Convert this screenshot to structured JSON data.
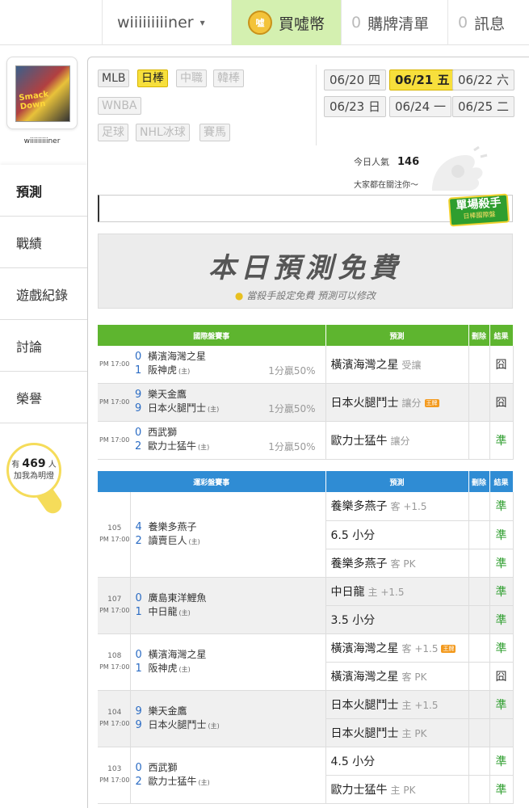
{
  "topbar": {
    "username": "wiiiiiiiiiner",
    "caret": "▾",
    "coin_icon": "噓",
    "coin_label": "買噓幣",
    "cart_count": "0",
    "cart_label": "購牌清單",
    "msg_count": "0",
    "msg_label": "訊息"
  },
  "sidebar": {
    "avatar_text": "Smack Down",
    "username": "wiiiiiiiiiner",
    "nav": [
      "預測",
      "戰績",
      "遊戲紀錄",
      "討論",
      "榮譽"
    ],
    "fans_prefix": "有",
    "fans_count": "469",
    "fans_suffix": "人",
    "fans_text": "加我為明燈"
  },
  "leagues": [
    "MLB",
    "日棒",
    "中職",
    "韓棒",
    "WNBA",
    "足球",
    "NHL冰球",
    "賽馬"
  ],
  "dates": [
    {
      "d": "06/20",
      "w": "四"
    },
    {
      "d": "06/21",
      "w": "五"
    },
    {
      "d": "06/22",
      "w": "六"
    },
    {
      "d": "06/23",
      "w": "日"
    },
    {
      "d": "06/24",
      "w": "一"
    },
    {
      "d": "06/25",
      "w": "二"
    }
  ],
  "popularity": {
    "label": "今日人氣",
    "value": "146",
    "sub": "大家都在關注你～"
  },
  "killer_badge": {
    "title": "單場殺手",
    "sub": "日棒國際盤"
  },
  "banner": {
    "title": "本日預測免費",
    "sub": "當殺手設定免費 預測可以修改"
  },
  "intl_table": {
    "headers": [
      "國際盤賽事",
      "預測",
      "刪除",
      "結果"
    ],
    "home_mark": "(主)",
    "rows": [
      {
        "time": "PM 17:00",
        "s1": "0",
        "t1": "橫濱海灣之星",
        "s2": "1",
        "t2": "阪神虎",
        "odds": "1分贏50%",
        "pick": "橫濱海灣之星",
        "pick_sub": "受讓",
        "badge": "",
        "result": "囧"
      },
      {
        "time": "PM 17:00",
        "s1": "9",
        "t1": "樂天金鷹",
        "s2": "9",
        "t2": "日本火腿鬥士",
        "odds": "1分贏50%",
        "pick": "日本火腿鬥士",
        "pick_sub": "讓分",
        "badge": "王牌",
        "result": "囧"
      },
      {
        "time": "PM 17:00",
        "s1": "0",
        "t1": "西武獅",
        "s2": "2",
        "t2": "歐力士猛牛",
        "odds": "1分贏50%",
        "pick": "歐力士猛牛",
        "pick_sub": "讓分",
        "badge": "",
        "result": "準"
      }
    ]
  },
  "sports_table": {
    "headers": [
      "運彩盤賽事",
      "預測",
      "刪除",
      "結果"
    ],
    "home_mark": "(主)",
    "games": [
      {
        "no": "105",
        "time": "PM 17:00",
        "s1": "4",
        "t1": "養樂多燕子",
        "s2": "2",
        "t2": "讀賣巨人",
        "picks": [
          {
            "pick": "養樂多燕子",
            "sub": "客 +1.5",
            "badge": "",
            "result": "準"
          },
          {
            "pick": "6.5 小分",
            "sub": "",
            "badge": "",
            "result": "準"
          },
          {
            "pick": "養樂多燕子",
            "sub": "客 PK",
            "badge": "",
            "result": "準"
          }
        ]
      },
      {
        "no": "107",
        "time": "PM 17:00",
        "s1": "0",
        "t1": "廣島東洋鯉魚",
        "s2": "1",
        "t2": "中日龍",
        "picks": [
          {
            "pick": "中日龍",
            "sub": "主 +1.5",
            "badge": "",
            "result": "準"
          },
          {
            "pick": "3.5 小分",
            "sub": "",
            "badge": "",
            "result": "準"
          }
        ]
      },
      {
        "no": "108",
        "time": "PM 17:00",
        "s1": "0",
        "t1": "橫濱海灣之星",
        "s2": "1",
        "t2": "阪神虎",
        "picks": [
          {
            "pick": "橫濱海灣之星",
            "sub": "客 +1.5",
            "badge": "王牌",
            "result": "準"
          },
          {
            "pick": "橫濱海灣之星",
            "sub": "客 PK",
            "badge": "",
            "result": "囧"
          }
        ]
      },
      {
        "no": "104",
        "time": "PM 17:00",
        "s1": "9",
        "t1": "樂天金鷹",
        "s2": "9",
        "t2": "日本火腿鬥士",
        "picks": [
          {
            "pick": "日本火腿鬥士",
            "sub": "主 +1.5",
            "badge": "",
            "result": "準"
          },
          {
            "pick": "日本火腿鬥士",
            "sub": "主 PK",
            "badge": "",
            "result": ""
          }
        ]
      },
      {
        "no": "103",
        "time": "PM 17:00",
        "s1": "0",
        "t1": "西武獅",
        "s2": "2",
        "t2": "歐力士猛牛",
        "picks": [
          {
            "pick": "4.5 小分",
            "sub": "",
            "badge": "",
            "result": "準"
          },
          {
            "pick": "歐力士猛牛",
            "sub": "主 PK",
            "badge": "",
            "result": "準"
          }
        ]
      }
    ]
  }
}
